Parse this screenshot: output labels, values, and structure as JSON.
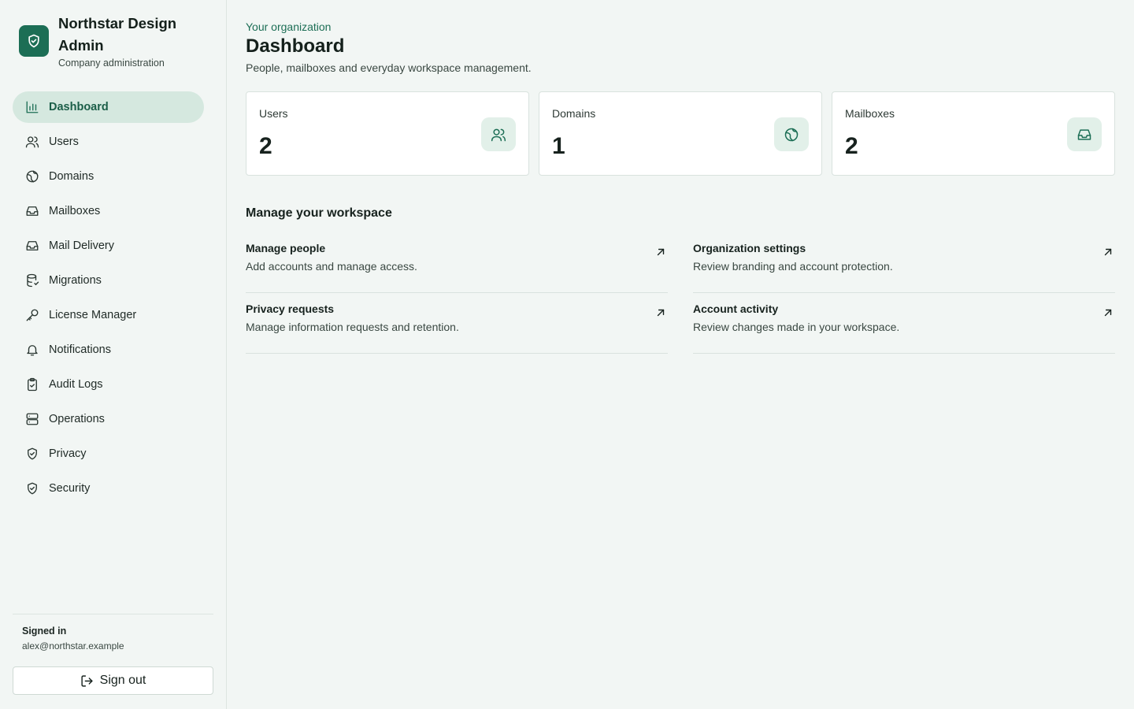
{
  "brand": {
    "name": "Northstar Design Admin",
    "subtitle": "Company administration",
    "accent": "#1c6e55",
    "icon": "shield-check-icon"
  },
  "sidebar": {
    "items": [
      {
        "label": "Dashboard",
        "icon": "bar-chart-icon",
        "active": true
      },
      {
        "label": "Users",
        "icon": "users-icon"
      },
      {
        "label": "Domains",
        "icon": "globe-icon"
      },
      {
        "label": "Mailboxes",
        "icon": "inbox-icon"
      },
      {
        "label": "Mail Delivery",
        "icon": "inbox-icon"
      },
      {
        "label": "Migrations",
        "icon": "database-icon"
      },
      {
        "label": "License Manager",
        "icon": "key-icon"
      },
      {
        "label": "Notifications",
        "icon": "bell-icon"
      },
      {
        "label": "Audit Logs",
        "icon": "clipboard-check-icon"
      },
      {
        "label": "Operations",
        "icon": "server-icon"
      },
      {
        "label": "Privacy",
        "icon": "shield-check-icon"
      },
      {
        "label": "Security",
        "icon": "shield-check-icon"
      }
    ],
    "footer": {
      "signed_in_label": "Signed in",
      "email": "alex@northstar.example",
      "signout_label": "Sign out"
    }
  },
  "header": {
    "eyebrow": "Your organization",
    "title": "Dashboard",
    "subtitle": "People, mailboxes and everyday workspace management."
  },
  "stats": [
    {
      "label": "Users",
      "value": "2",
      "icon": "users-icon"
    },
    {
      "label": "Domains",
      "value": "1",
      "icon": "globe-icon"
    },
    {
      "label": "Mailboxes",
      "value": "2",
      "icon": "inbox-icon"
    }
  ],
  "workspace": {
    "title": "Manage your workspace",
    "actions": [
      {
        "title": "Manage people",
        "description": "Add accounts and manage access."
      },
      {
        "title": "Organization settings",
        "description": "Review branding and account protection."
      },
      {
        "title": "Privacy requests",
        "description": "Manage information requests and retention."
      },
      {
        "title": "Account activity",
        "description": "Review changes made in your workspace."
      }
    ]
  }
}
